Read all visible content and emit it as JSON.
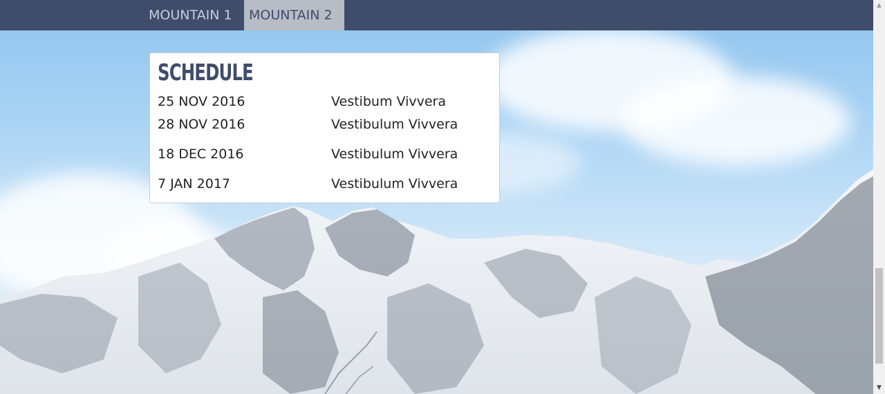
{
  "nav": {
    "items": [
      {
        "label": "MOUNTAIN 1",
        "active": false
      },
      {
        "label": "MOUNTAIN 2",
        "active": true
      }
    ]
  },
  "schedule": {
    "title": "SCHEDULE",
    "rows": [
      {
        "date": "25 NOV 2016",
        "event": "Vestibum Vivvera"
      },
      {
        "date": "28 NOV 2016",
        "event": "Vestibulum Vivvera"
      },
      {
        "date": "18 DEC 2016",
        "event": "Vestibulum Vivvera"
      },
      {
        "date": "7 JAN 2017",
        "event": "Vestibulum Vivvera"
      }
    ]
  },
  "colors": {
    "navbar": "#3f4c6a",
    "nav_active_bg": "#b7bcc6",
    "nav_text": "#c8cfdc",
    "title": "#3f4c6a"
  },
  "icons": {
    "scroll_up": "scroll-up-arrow-icon",
    "scroll_down": "scroll-down-arrow-icon"
  }
}
